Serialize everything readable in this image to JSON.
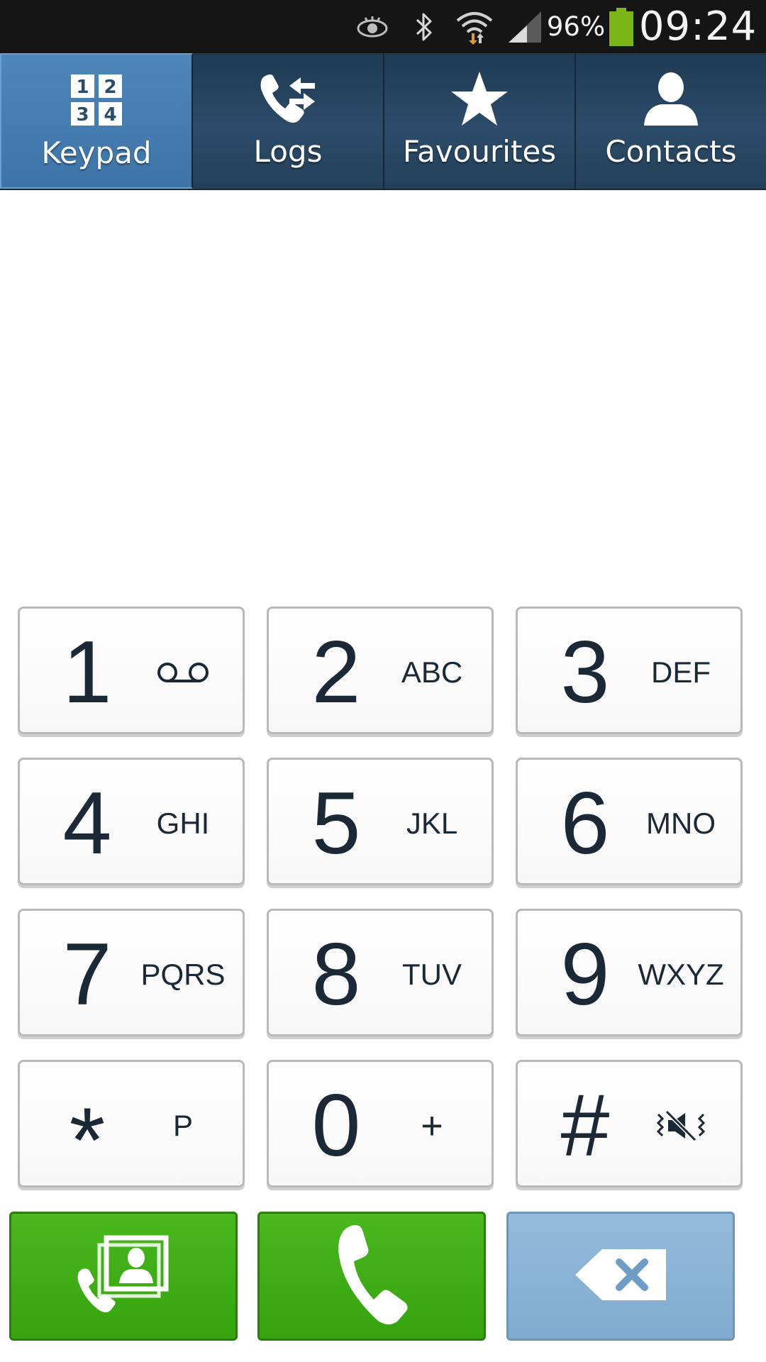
{
  "status_bar": {
    "icons": [
      "eye-icon",
      "bluetooth-icon",
      "wifi-icon",
      "signal-icon",
      "battery-icon"
    ],
    "battery_percent": "96%",
    "time": "09:24",
    "battery_color": "#7cb518"
  },
  "tabs": [
    {
      "label": "Keypad",
      "icon": "keypad-icon",
      "active": true
    },
    {
      "label": "Logs",
      "icon": "call-logs-icon",
      "active": false
    },
    {
      "label": "Favourites",
      "icon": "star-icon",
      "active": false
    },
    {
      "label": "Contacts",
      "icon": "contact-icon",
      "active": false
    }
  ],
  "display": {
    "number": ""
  },
  "keypad": {
    "keys": [
      {
        "digit": "1",
        "letters": "",
        "sub_icon": "voicemail-icon"
      },
      {
        "digit": "2",
        "letters": "ABC"
      },
      {
        "digit": "3",
        "letters": "DEF"
      },
      {
        "digit": "4",
        "letters": "GHI"
      },
      {
        "digit": "5",
        "letters": "JKL"
      },
      {
        "digit": "6",
        "letters": "MNO"
      },
      {
        "digit": "7",
        "letters": "PQRS"
      },
      {
        "digit": "8",
        "letters": "TUV"
      },
      {
        "digit": "9",
        "letters": "WXYZ"
      },
      {
        "digit": "*",
        "letters": "P"
      },
      {
        "digit": "0",
        "letters": "+"
      },
      {
        "digit": "#",
        "letters": "",
        "sub_icon": "vibrate-mute-icon"
      }
    ]
  },
  "actions": {
    "video_call_icon": "contact-card-call-icon",
    "call_icon": "phone-call-icon",
    "delete_icon": "backspace-icon",
    "green_color": "#3aa80f",
    "blue_color": "#88b3d6"
  }
}
